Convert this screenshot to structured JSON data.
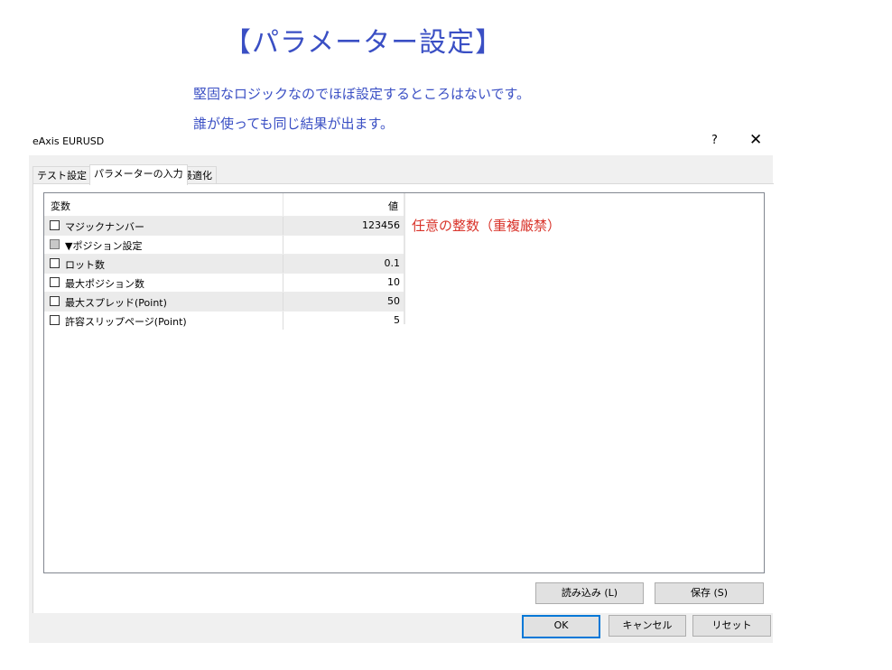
{
  "heading": "【パラメーター設定】",
  "description": [
    "堅固なロジックなのでほぼ設定するところはないです。",
    "誰が使っても同じ結果が出ます。"
  ],
  "dialog": {
    "title": "eAxis EURUSD",
    "help_label": "?",
    "close_label": "✕",
    "tabs": [
      "テスト設定",
      "パラメーターの入力",
      "最適化"
    ],
    "active_tab": "パラメーターの入力",
    "table": {
      "headers": {
        "name": "変数",
        "value": "値"
      },
      "rows": [
        {
          "label": "マジックナンバー",
          "value": "123456",
          "checked": false
        },
        {
          "label": "▼ポジション設定",
          "value": "",
          "checked": false
        },
        {
          "label": "ロット数",
          "value": "0.1",
          "checked": false
        },
        {
          "label": "最大ポジション数",
          "value": "10",
          "checked": false
        },
        {
          "label": "最大スプレッド(Point)",
          "value": "50",
          "checked": false
        },
        {
          "label": "許容スリップページ(Point)",
          "value": "5",
          "checked": false
        }
      ]
    },
    "buttons": {
      "load": "読み込み (L)",
      "save": "保存 (S)",
      "ok": "OK",
      "cancel": "キャンセル",
      "reset": "リセット"
    }
  },
  "annotation": "任意の整数（重複厳禁）",
  "colors": {
    "heading": "#3a4fc4",
    "annotation": "#d9342b",
    "default_button_border": "#0078d7"
  }
}
